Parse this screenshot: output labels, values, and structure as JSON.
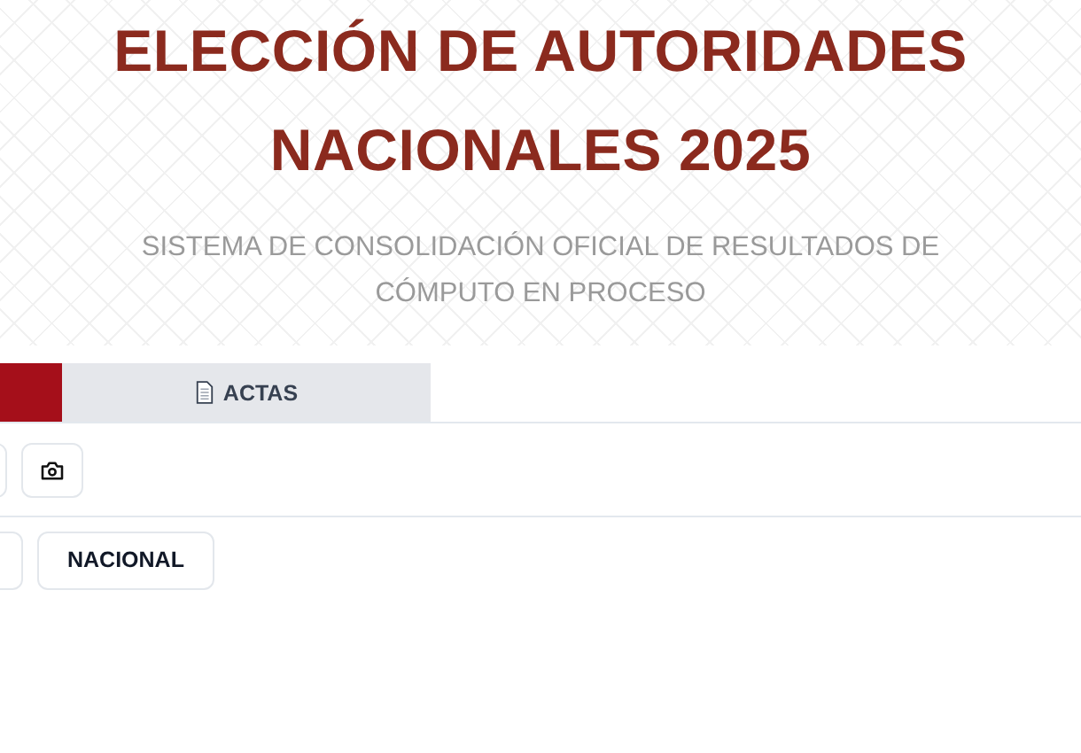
{
  "header": {
    "title": "ELECCIÓN DE AUTORIDADES NACIONALES 2025",
    "subtitle": "SISTEMA DE CONSOLIDACIÓN OFICIAL DE RESULTADOS DE CÓMPUTO EN PROCESO"
  },
  "tabs": [
    {
      "selected": true
    },
    {
      "label": "ACTAS",
      "selected": false
    }
  ],
  "toolbar": [
    {
      "kind": "cut"
    },
    {
      "kind": "camera"
    }
  ],
  "scope_buttons": [
    {
      "kind": "cut"
    },
    {
      "kind": "text",
      "label": "NACIONAL"
    }
  ]
}
